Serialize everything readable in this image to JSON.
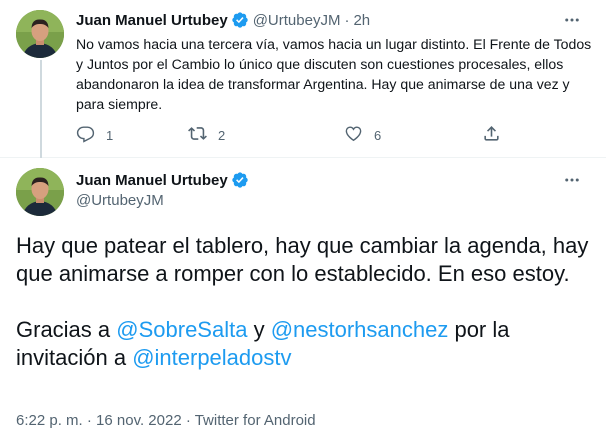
{
  "tweet1": {
    "author_name": "Juan Manuel Urtubey",
    "handle": "@UrtubeyJM",
    "separator": "·",
    "time": "2h",
    "text": "No vamos hacia una tercera vía, vamos hacia un lugar distinto. El Frente de Todos y Juntos por el Cambio lo único que discuten son cuestiones procesales, ellos abandonaron la idea de transformar Argentina. Hay que animarse de una vez y para siempre.",
    "replies": "1",
    "retweets": "2",
    "likes": "6"
  },
  "tweet2": {
    "author_name": "Juan Manuel Urtubey",
    "handle": "@UrtubeyJM",
    "paragraph1": "Hay que patear el tablero, hay que cambiar la agenda, hay que animarse a romper con lo establecido. En eso estoy.",
    "p2_part1": "Gracias a ",
    "mention1": "@SobreSalta",
    "p2_part2": " y ",
    "mention2": "@nestorhsanchez",
    "p2_part3": " por la invitación a ",
    "mention3": "@interpeladostv",
    "timestamp": "6:22 p. m. · 16 nov. 2022 · Twitter for Android"
  },
  "colors": {
    "accent": "#1d9bf0",
    "muted": "#536471",
    "text": "#0f1419",
    "thread_line": "#cfd9de"
  },
  "icons": [
    "verified-badge-icon",
    "more-options-icon",
    "reply-icon",
    "retweet-icon",
    "like-icon",
    "share-icon"
  ]
}
